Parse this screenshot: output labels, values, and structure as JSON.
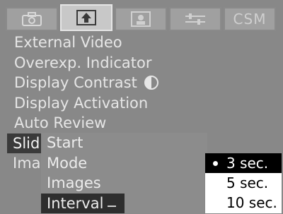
{
  "tabs": [
    {
      "name": "camera",
      "label": ""
    },
    {
      "name": "playback",
      "label": ""
    },
    {
      "name": "user",
      "label": ""
    },
    {
      "name": "setup",
      "label": ""
    },
    {
      "name": "csm",
      "label": "CSM"
    }
  ],
  "menu": {
    "items": [
      "External Video",
      "Overexp. Indicator",
      "Display Contrast",
      "Display Activation",
      "Auto Review"
    ],
    "truncated": [
      "Slid",
      "Ima"
    ]
  },
  "submenu": {
    "items": [
      "Start",
      "Mode",
      "Images",
      "Interval"
    ]
  },
  "interval_popup": {
    "options": [
      "3 sec.",
      "5 sec.",
      "10 sec."
    ],
    "selected": "3 sec."
  },
  "colors": {
    "highlight": "#2e2e2e",
    "popup_bg": "#ffffff"
  }
}
